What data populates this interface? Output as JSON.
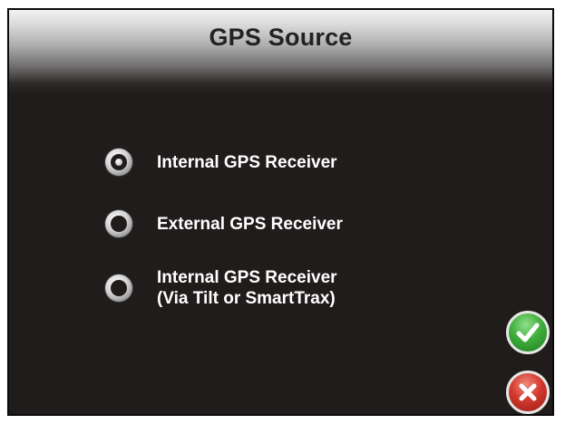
{
  "dialog": {
    "title": "GPS Source"
  },
  "options": [
    {
      "lines": [
        "Internal GPS Receiver"
      ],
      "selected": true
    },
    {
      "lines": [
        "External GPS Receiver"
      ],
      "selected": false
    },
    {
      "lines": [
        "Internal GPS Receiver",
        "(Via Tilt or SmartTrax)"
      ],
      "selected": false
    }
  ],
  "icons": {
    "accept": "checkmark-icon",
    "cancel": "x-icon"
  },
  "colors": {
    "background": "#201c1b",
    "accept": "#3fae3c",
    "cancel": "#d3392d",
    "text": "#ffffff",
    "title_text": "#222222"
  }
}
